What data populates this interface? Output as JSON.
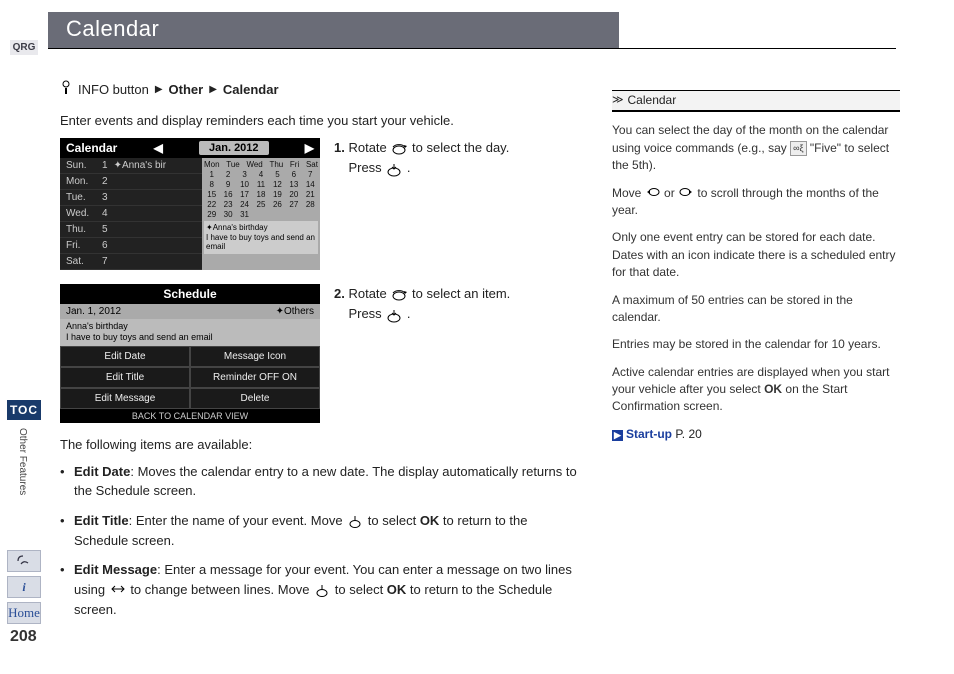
{
  "page_number": "208",
  "header": {
    "title": "Calendar"
  },
  "left_nav": {
    "qrg": "QRG",
    "toc": "TOC",
    "section_label": "Other Features",
    "home_label": "Home"
  },
  "breadcrumb": {
    "info_label": "INFO button",
    "seg2": "Other",
    "seg3": "Calendar"
  },
  "intro": "Enter events and display reminders each time you start your vehicle.",
  "screenshot1": {
    "title": "Calendar",
    "month": "Jan. 2012",
    "rows": [
      {
        "dow": "Sun.",
        "day": "1",
        "label": "✦Anna's bir"
      },
      {
        "dow": "Mon.",
        "day": "2",
        "label": ""
      },
      {
        "dow": "Tue.",
        "day": "3",
        "label": ""
      },
      {
        "dow": "Wed.",
        "day": "4",
        "label": ""
      },
      {
        "dow": "Thu.",
        "day": "5",
        "label": ""
      },
      {
        "dow": "Fri.",
        "day": "6",
        "label": ""
      },
      {
        "dow": "Sat.",
        "day": "7",
        "label": ""
      }
    ],
    "dow_header": [
      "Mon",
      "Tue",
      "Wed",
      "Thu",
      "Fri",
      "Sat"
    ],
    "cal_days": [
      "1",
      "2",
      "3",
      "4",
      "5",
      "6",
      "7",
      "8",
      "9",
      "10",
      "11",
      "12",
      "13",
      "14",
      "15",
      "16",
      "17",
      "18",
      "19",
      "20",
      "21",
      "22",
      "23",
      "24",
      "25",
      "26",
      "27",
      "28",
      "29",
      "30",
      "31",
      "",
      "",
      "",
      ""
    ],
    "event_title": "✦Anna's birthday",
    "event_body": "I have to buy toys and send an email"
  },
  "step1": {
    "num": "1.",
    "line1a": "Rotate ",
    "line1b": " to select the day.",
    "line2a": "Press ",
    "line2b": "."
  },
  "screenshot2": {
    "title": "Schedule",
    "date": "Jan. 1, 2012",
    "others": "✦Others",
    "ev_title": "Anna's birthday",
    "ev_body": "I have to buy toys and send an email",
    "btn1": "Edit Date",
    "btn2": "Message Icon",
    "btn3": "Edit Title",
    "btn4": "Reminder OFF ON",
    "btn5": "Edit Message",
    "btn6": "Delete",
    "footer": "BACK TO CALENDAR VIEW"
  },
  "step2": {
    "num": "2.",
    "line1a": "Rotate ",
    "line1b": " to select an item.",
    "line2a": "Press ",
    "line2b": "."
  },
  "available_intro": "The following items are available:",
  "bullets": {
    "b1_label": "Edit Date",
    "b1_text": ": Moves the calendar entry to a new date. The display automatically returns to the Schedule screen.",
    "b2_label": "Edit Title",
    "b2_text_a": ": Enter the name of your event. Move ",
    "b2_text_b": " to select ",
    "b2_ok": "OK",
    "b2_text_c": " to return to the Schedule screen.",
    "b3_label": "Edit Message",
    "b3_text_a": ": Enter a message for your event. You can enter a message on two lines using ",
    "b3_text_b": " to change between lines. Move ",
    "b3_text_c": " to select ",
    "b3_ok": "OK",
    "b3_text_d": " to return to the Schedule screen."
  },
  "sidebar": {
    "title": "Calendar",
    "p1a": "You can select the day of the month on the calendar using voice commands (e.g., say ",
    "p1b": " \"Five\" to select the 5th).",
    "p2a": "Move ",
    "p2b": " or ",
    "p2c": " to scroll through the months of the year.",
    "p3": "Only one event entry can be stored for each date. Dates with an icon indicate there is a scheduled entry for that date.",
    "p4": "A maximum of 50 entries can be stored in the calendar.",
    "p5": "Entries may be stored in the calendar for 10 years.",
    "p6a": "Active calendar entries are displayed when you start your vehicle after you select ",
    "p6_ok": "OK",
    "p6b": " on the Start Confirmation screen.",
    "link_label": "Start-up",
    "link_page": "P. 20"
  }
}
